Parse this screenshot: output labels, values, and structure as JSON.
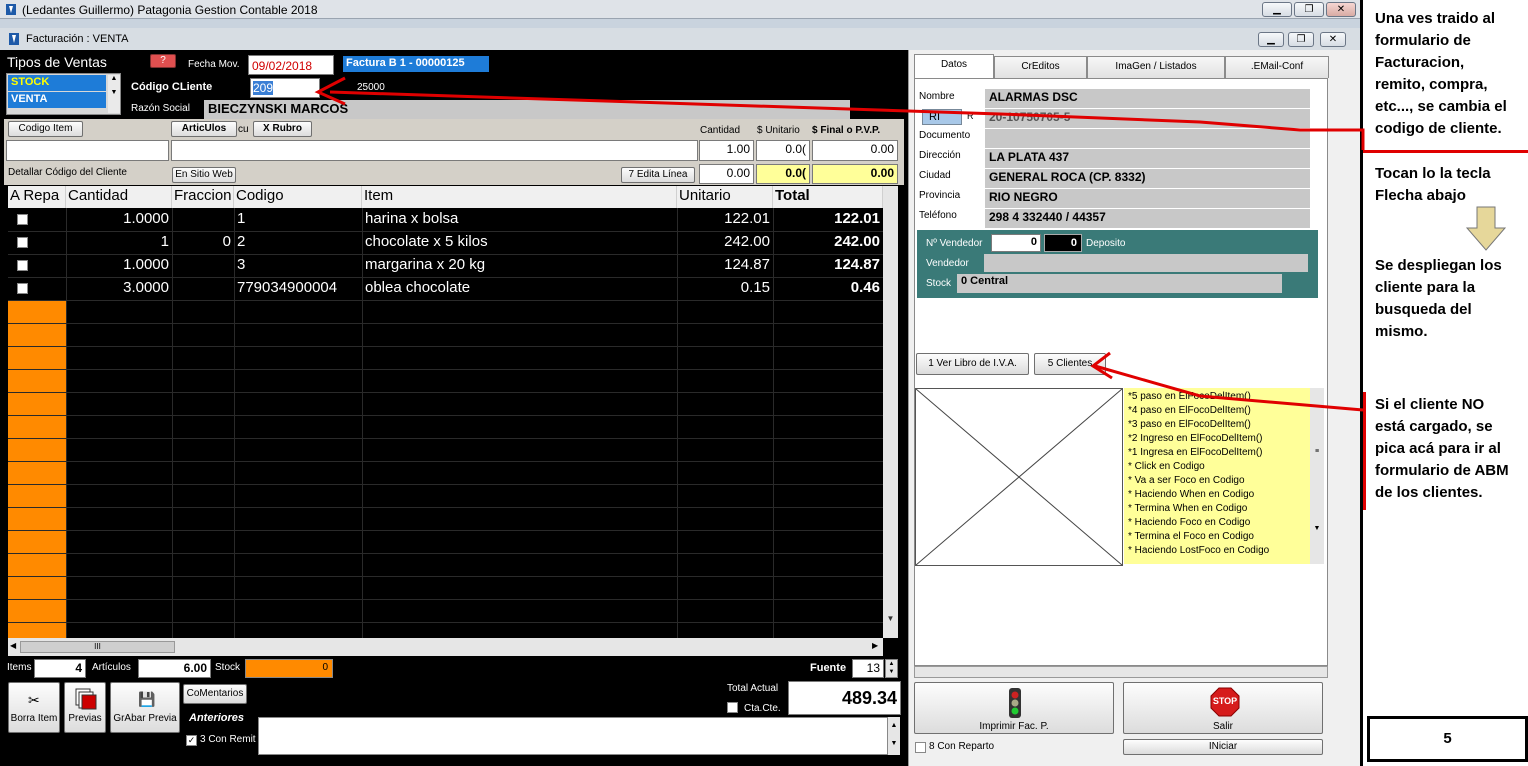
{
  "window": {
    "title": "(Ledantes Guillermo) Patagonia Gestion Contable 2018",
    "subtitle": "Facturación : VENTA"
  },
  "sales_types": {
    "label": "Tipos de Ventas",
    "items": [
      "STOCK",
      "VENTA"
    ]
  },
  "header": {
    "help_label": "?",
    "fecha_label": "Fecha Mov.",
    "fecha_value": "09/02/2018",
    "factura_label": "Factura  B   1 - 00000125",
    "codigo_label": "Código CLiente",
    "codigo_value": "209",
    "codigo_extra": "25000",
    "razon_label": "Razón Social",
    "razon_value": "BIECZYNSKI MARCOS"
  },
  "item_entry": {
    "codigo_item_btn": "Codigo Item",
    "articulos_btn": "ArticUlos",
    "cu_text": "cu",
    "rubro_btn": "X Rubro",
    "cantidad_label": "Cantidad",
    "unitario_label": "$ Unitario",
    "final_label": "$ Final o P.V.P.",
    "cantidad_value": "1.00",
    "unitario_value": "0.0(",
    "final_value": "0.00",
    "detallar_label": "Detallar Código del Cliente",
    "sitio_web_btn": "En Sitio Web",
    "edita_linea_btn": "7 Edita Línea",
    "row2_a": "0.00",
    "row2_b": "0.0(",
    "row2_c": "0.00"
  },
  "grid": {
    "columns": [
      "A Repa",
      "Cantidad",
      "Fraccion",
      "Codigo",
      "Item",
      "Unitario",
      "Total"
    ],
    "rows": [
      {
        "cantidad": "1.0000",
        "fraccion": "",
        "codigo": "1",
        "item": "harina x bolsa",
        "unitario": "122.01",
        "total": "122.01"
      },
      {
        "cantidad": "1",
        "fraccion": "0",
        "codigo": "2",
        "item": "chocolate x 5 kilos",
        "unitario": "242.00",
        "total": "242.00"
      },
      {
        "cantidad": "1.0000",
        "fraccion": "",
        "codigo": "3",
        "item": "margarina x 20 kg",
        "unitario": "124.87",
        "total": "124.87"
      },
      {
        "cantidad": "3.0000",
        "fraccion": "",
        "codigo": "779034900004",
        "item": "oblea chocolate",
        "unitario": "0.15",
        "total": "0.46"
      }
    ],
    "scroll_glyph": "III"
  },
  "footer": {
    "items_label": "Items",
    "items_value": "4",
    "articulos_label": "Artículos",
    "articulos_value": "6.00",
    "stock_label": "Stock",
    "stock_value": "0",
    "fuente_label": "Fuente",
    "fuente_value": "13",
    "total_label": "Total Actual",
    "total_value": "489.34",
    "ctacte_label": "Cta.Cte.",
    "borra_btn": "Borra Item",
    "previas_btn": "Previas",
    "grabar_btn": "GrAbar Previa",
    "comentarios_btn": "CoMentarios",
    "anteriores_label": "Anteriores",
    "remito_label": "3 Con Remit"
  },
  "right_panel": {
    "tabs": [
      "Datos",
      "CrEditos",
      "ImaGen / Listados",
      ".EMail-Conf"
    ],
    "nombre_label": "Nombre",
    "nombre_value": "ALARMAS DSC",
    "ri_value": "RI",
    "r_label": "R",
    "documento_label": "Documento",
    "documento_value": "20-10750705-5",
    "direccion_label": "Dirección",
    "direccion_value": "LA PLATA 437",
    "ciudad_label": "Ciudad",
    "ciudad_value": "GENERAL ROCA  (CP. 8332)",
    "provincia_label": "Provincia",
    "provincia_value": "RIO NEGRO",
    "telefono_label": "Teléfono",
    "telefono_value": "298 4 332440 / 44357",
    "vendedor_no_label": "Nº Vendedor",
    "vendedor_no_value": "0",
    "deposito_value": "0",
    "deposito_label": "Deposito",
    "vendedor_label": "Vendedor",
    "stock_label": "Stock",
    "stock_value": "0  Central",
    "iva_btn": "1 Ver Libro de I.V.A.",
    "clientes_btn": "5 Clientes",
    "log": [
      "*5 paso en ElFocoDelItem()",
      "*4 paso en ElFocoDelItem()",
      "*3 paso en ElFocoDelItem()",
      "*2 Ingreso en ElFocoDelItem()",
      "*1 Ingresa en ElFocoDelItem()",
      "* Click en Codigo",
      "* Va a ser Foco en Codigo",
      "* Haciendo When en Codigo",
      "* Termina When en Codigo",
      "* Haciendo Foco en Codigo",
      "* Termina el Foco en Codigo",
      "* Haciendo LostFoco en Codigo"
    ],
    "imprimir_btn": "Imprimir Fac. P.",
    "salir_btn": "Salir",
    "stop_text": "STOP",
    "reparto_label": "8 Con Reparto",
    "iniciar_btn": "INiciar"
  },
  "annotations": {
    "note1": [
      "Una ves traido al",
      "formulario de",
      "Facturacion,",
      "remito, compra,",
      "etc..., se cambia el",
      "codigo de cliente."
    ],
    "note2": [
      "Tocan lo la tecla",
      "Flecha abajo"
    ],
    "note3": [
      "Se despliegan los",
      "cliente para la",
      "busqueda del",
      "mismo."
    ],
    "note4": [
      "Si el cliente NO",
      "está cargado, se",
      "pica acá para ir al",
      "formulario de ABM",
      "de los clientes."
    ],
    "page_number": "5"
  },
  "colors": {
    "accent_orange": "#ff8a00",
    "highlight_blue": "#1e7cd8",
    "panel_teal": "#3a7a78",
    "annotation_red": "#e00000",
    "log_yellow": "#ffff99"
  }
}
